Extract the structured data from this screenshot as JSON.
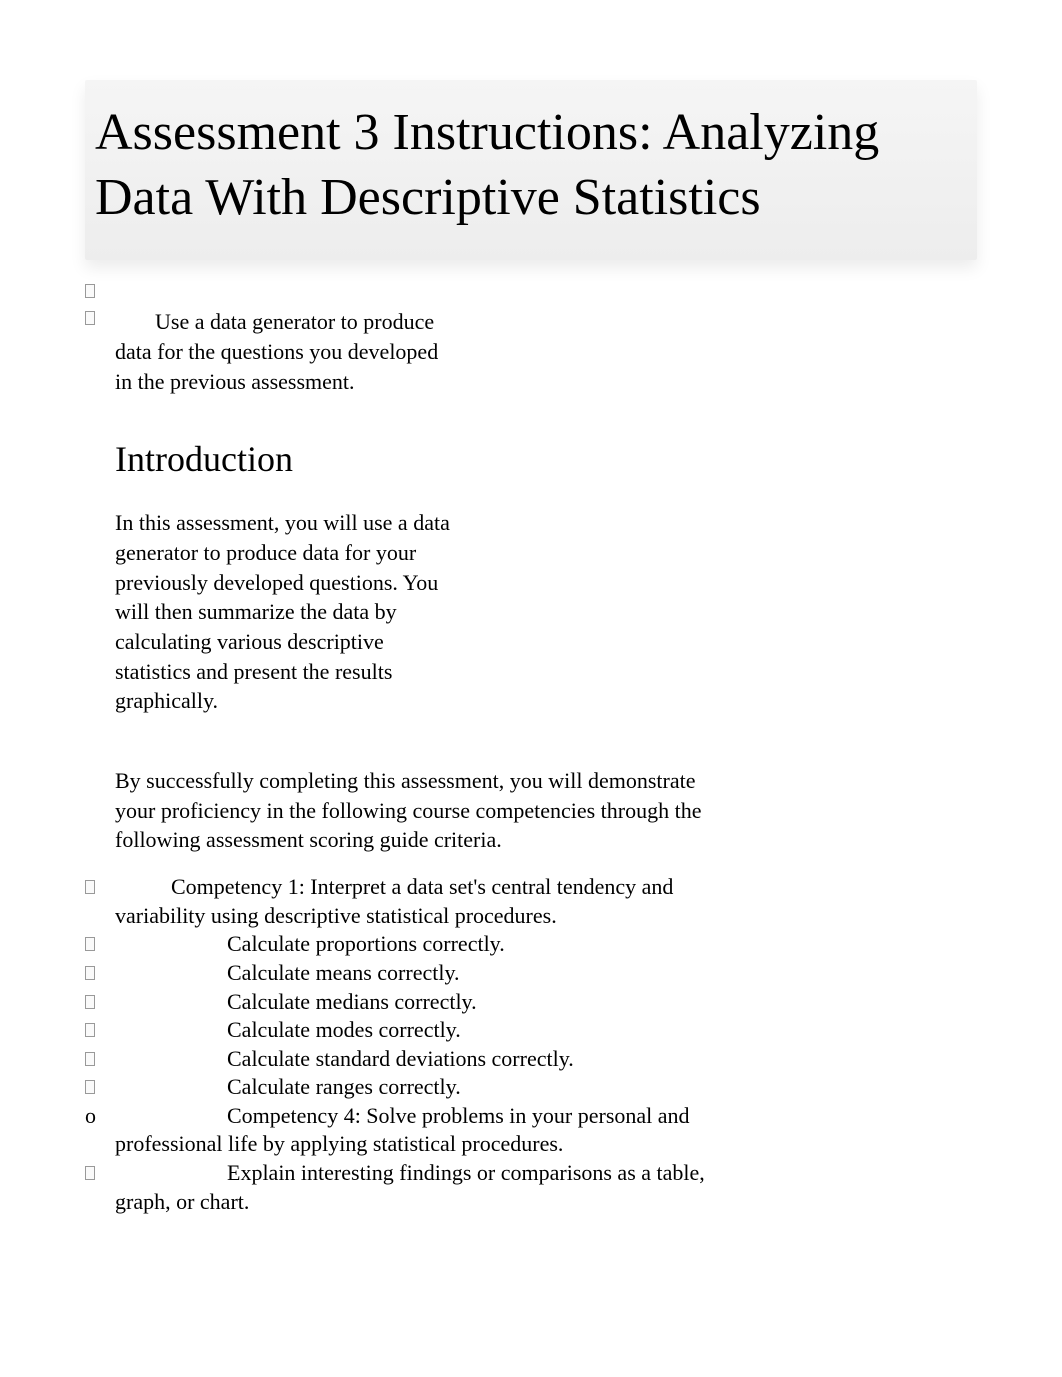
{
  "title": "Assessment 3 Instructions: Analyzing Data With Descriptive Statistics",
  "intro_bullet": "Use a data generator to produce data for the questions you developed in the previous assessment.",
  "section_heading": "Introduction",
  "intro_paragraph": "In this assessment, you will use a data generator to produce data for your previously developed questions. You will then summarize the data by calculating various descriptive statistics and present the results graphically.",
  "competency_intro": "By successfully completing this assessment, you will demonstrate your proficiency in the following course competencies through the following assessment scoring guide criteria.",
  "bullets": {
    "glyph_placeholder": "",
    "o": "o"
  },
  "items": [
    {
      "level": 1,
      "bullet": "glyph",
      "text": "Competency 1: Interpret a data set's central tendency and variability using descriptive statistical procedures."
    },
    {
      "level": 2,
      "bullet": "glyph",
      "text": "Calculate proportions correctly."
    },
    {
      "level": 2,
      "bullet": "glyph",
      "text": "Calculate means correctly."
    },
    {
      "level": 2,
      "bullet": "glyph",
      "text": "Calculate medians correctly."
    },
    {
      "level": 2,
      "bullet": "glyph",
      "text": "Calculate modes correctly."
    },
    {
      "level": 2,
      "bullet": "glyph",
      "text": "Calculate standard deviations correctly."
    },
    {
      "level": 2,
      "bullet": "glyph",
      "text": "Calculate ranges correctly."
    },
    {
      "level": 2,
      "bullet": "o",
      "text": "Competency 4: Solve problems in your personal and professional life by applying statistical procedures."
    },
    {
      "level": 2,
      "bullet": "glyph",
      "text": "Explain interesting findings or comparisons as a table, graph, or chart."
    }
  ]
}
